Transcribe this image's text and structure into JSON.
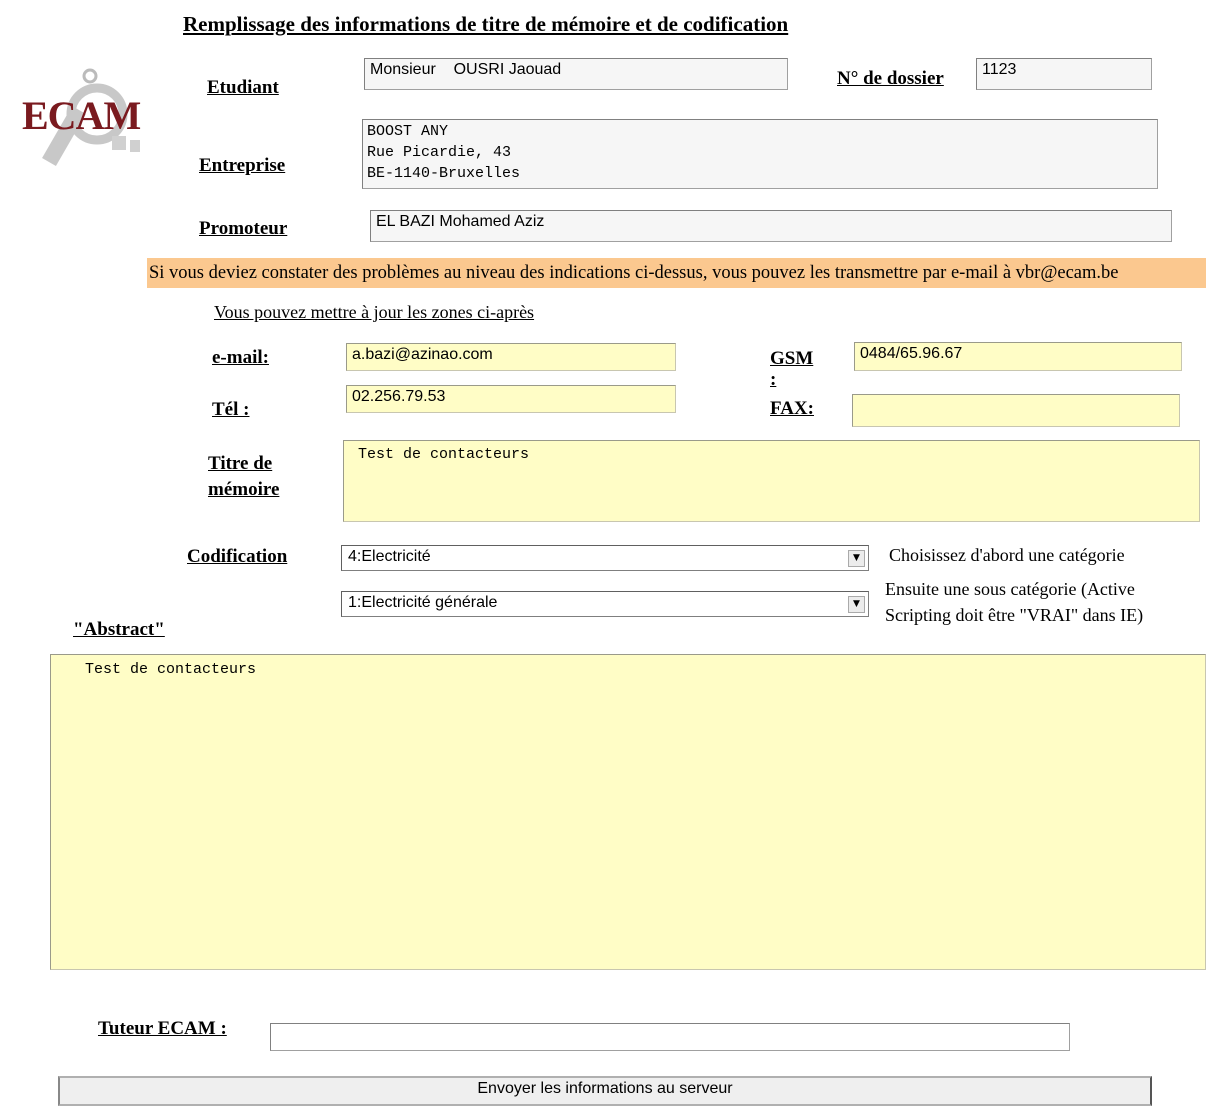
{
  "page_title": "Remplissage des informations de titre de mémoire et de codification",
  "logo_text": "ECAM",
  "labels": {
    "etudiant": "Etudiant",
    "dossier": "N° de dossier",
    "entreprise": "Entreprise",
    "promoteur": "Promoteur",
    "email": "e-mail:",
    "gsm": "GSM",
    "colon": ":",
    "tel": "Tél :",
    "fax": "FAX:",
    "titre_line1": "Titre de",
    "titre_line2": "mémoire",
    "codification": "Codification",
    "abstract": "\"Abstract\"",
    "tuteur": "Tuteur ECAM :"
  },
  "values": {
    "etudiant": "Monsieur    OUSRI Jaouad",
    "dossier": "1123",
    "entreprise": "BOOST ANY\nRue Picardie, 43\nBE-1140-Bruxelles",
    "promoteur": "EL BAZI Mohamed Aziz",
    "email": "a.bazi@azinao.com",
    "gsm": "0484/65.96.67",
    "tel": "02.256.79.53",
    "fax": "",
    "titre": "Test de contacteurs",
    "abstract": "Test de contacteurs",
    "tuteur": ""
  },
  "banner": "Si vous deviez constater des problèmes au niveau des indications ci-dessus, vous pouvez les transmettre par e-mail à vbr@ecam.be",
  "update_hint": "Vous pouvez mettre à jour les zones ci-après",
  "codification": {
    "category_selected": "4:Electricité",
    "subcategory_selected": "1:Electricité générale",
    "category_hint": "Choisissez d'abord une catégorie",
    "subcategory_hint_line1": "Ensuite une sous catégorie (Active",
    "subcategory_hint_line2": "Scripting doit être \"VRAI\" dans IE)"
  },
  "submit_label": "Envoyer les informations au serveur",
  "colors": {
    "banner_bg": "#fbc88f",
    "editable_bg": "#fffdc6",
    "logo": "#7a1a1f"
  },
  "icons": {
    "logo": "ecam-gear-logo",
    "dropdown": "chevron-down-icon"
  }
}
